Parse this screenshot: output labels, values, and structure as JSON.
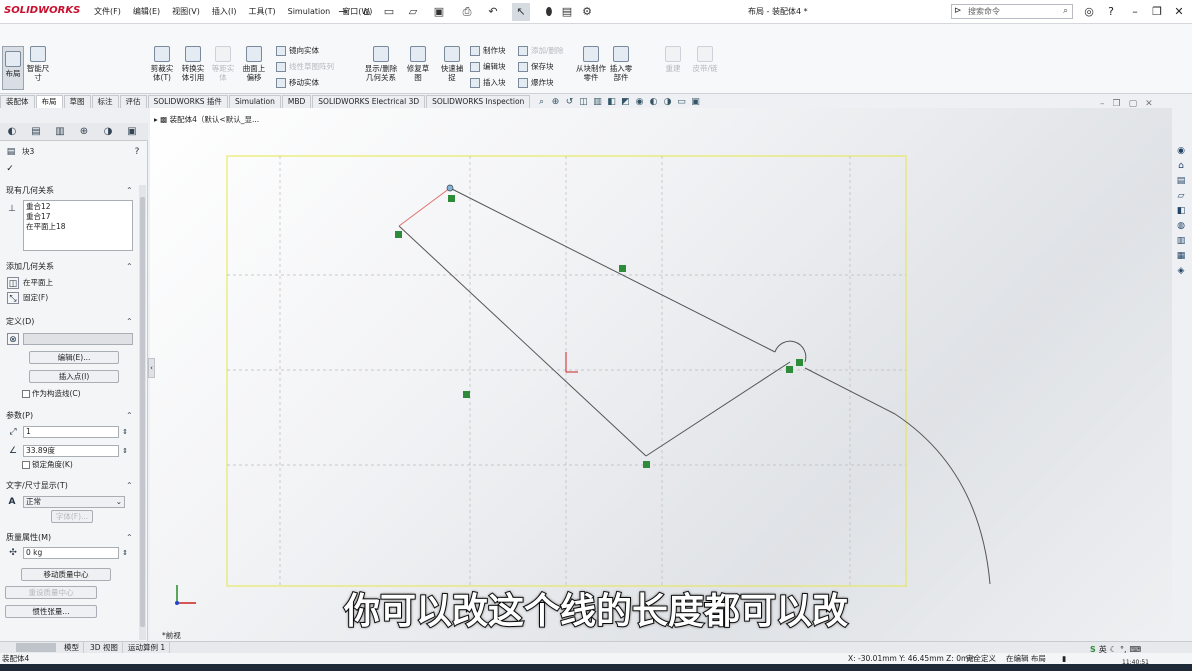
{
  "app": {
    "logo": "SOLIDWORKS",
    "doc_title": "布局 - 装配体4 *"
  },
  "menu": [
    "文件(F)",
    "编辑(E)",
    "视图(V)",
    "插入(I)",
    "工具(T)",
    "Simulation",
    "窗口(W)"
  ],
  "search": {
    "placeholder": "搜索命令"
  },
  "ribbon": {
    "layout": "布局",
    "smart_dim": "智能尺寸",
    "cut_entity": "剪裁实体(T)",
    "convert_entity": "转换实体引用",
    "offset_entity": "等距实体",
    "surface_offset": "曲面上偏移",
    "mirror_entity": "镜向实体",
    "linear_pattern": "线性草图阵列",
    "move_entity": "移动实体",
    "show_relations": "显示/删除几何关系",
    "repair_sketch": "修复草图",
    "quick_snap": "快速捕捉",
    "make_block": "制作块",
    "edit_block": "编辑块",
    "insert_block": "插入块",
    "add_remove": "添加/删除",
    "save_block": "保存块",
    "explode_block": "爆炸块",
    "make_part_from_block": "从块制作零件",
    "insert_part": "插入零部件",
    "rebuild": "重建",
    "belt_chain": "皮带/链"
  },
  "tabs": [
    "装配体",
    "布局",
    "草图",
    "标注",
    "评估",
    "SOLIDWORKS 插件",
    "Simulation",
    "MBD",
    "SOLIDWORKS Electrical 3D",
    "SOLIDWORKS Inspection"
  ],
  "active_tab": "布局",
  "tree": {
    "label": "装配体4（默认<默认_显..."
  },
  "panel": {
    "title": "块3",
    "existing_relations": {
      "title": "现有几何关系",
      "items": [
        "重合12",
        "重合17",
        "在平面上18"
      ]
    },
    "add_relations": {
      "title": "添加几何关系",
      "items": [
        "在平面上",
        "固定(F)"
      ]
    },
    "definition": {
      "title": "定义(D)",
      "edit_btn": "编辑(E)...",
      "insert_point_btn": "插入点(I)",
      "construction_cb": "作为构造线(C)"
    },
    "params": {
      "title": "参数(P)",
      "scale": "1",
      "angle": "33.89度",
      "lock_angle": "锁定角度(K)"
    },
    "text_dim": {
      "title": "文字/尺寸显示(T)",
      "style": "正常",
      "font_btn": "字体(F)..."
    },
    "mass": {
      "title": "质量属性(M)",
      "mass_value": "0 kg",
      "move_center_btn": "移动质量中心",
      "reset_center_btn": "重设质量中心",
      "inertia_btn": "惯性张量..."
    }
  },
  "view_label": "*前视",
  "bottom_tabs": [
    "模型",
    "3D 视图",
    "运动算例 1"
  ],
  "status": {
    "left": "装配体4",
    "coords": "X: -30.01mm Y: 46.45mm Z: 0mm",
    "defined": "完全定义",
    "editing": "在编辑 布局",
    "time": "11:40:51"
  },
  "ime": {
    "label": "英"
  },
  "subtitle": "你可以改这个线的长度都可以改",
  "colors": {
    "accent": "#c8102e",
    "sketch_line": "#555555",
    "frame": "#e8e840",
    "relation_marker": "#2e8b3a"
  }
}
